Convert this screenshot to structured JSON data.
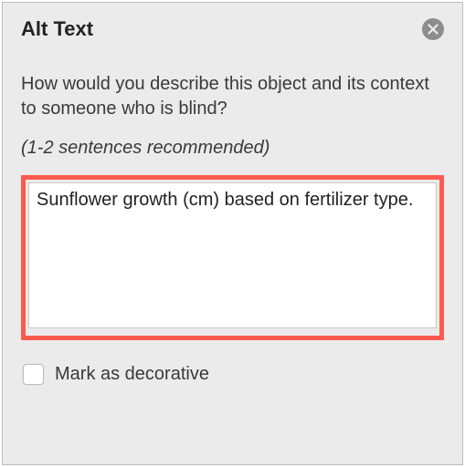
{
  "panel": {
    "title": "Alt Text",
    "prompt": "How would you describe this object and its context to someone who is blind?",
    "recommendation": "(1-2 sentences recommended)",
    "alt_text_value": "Sunflower growth (cm) based on fertilizer type. ",
    "decorative_label": "Mark as decorative",
    "decorative_checked": false
  }
}
